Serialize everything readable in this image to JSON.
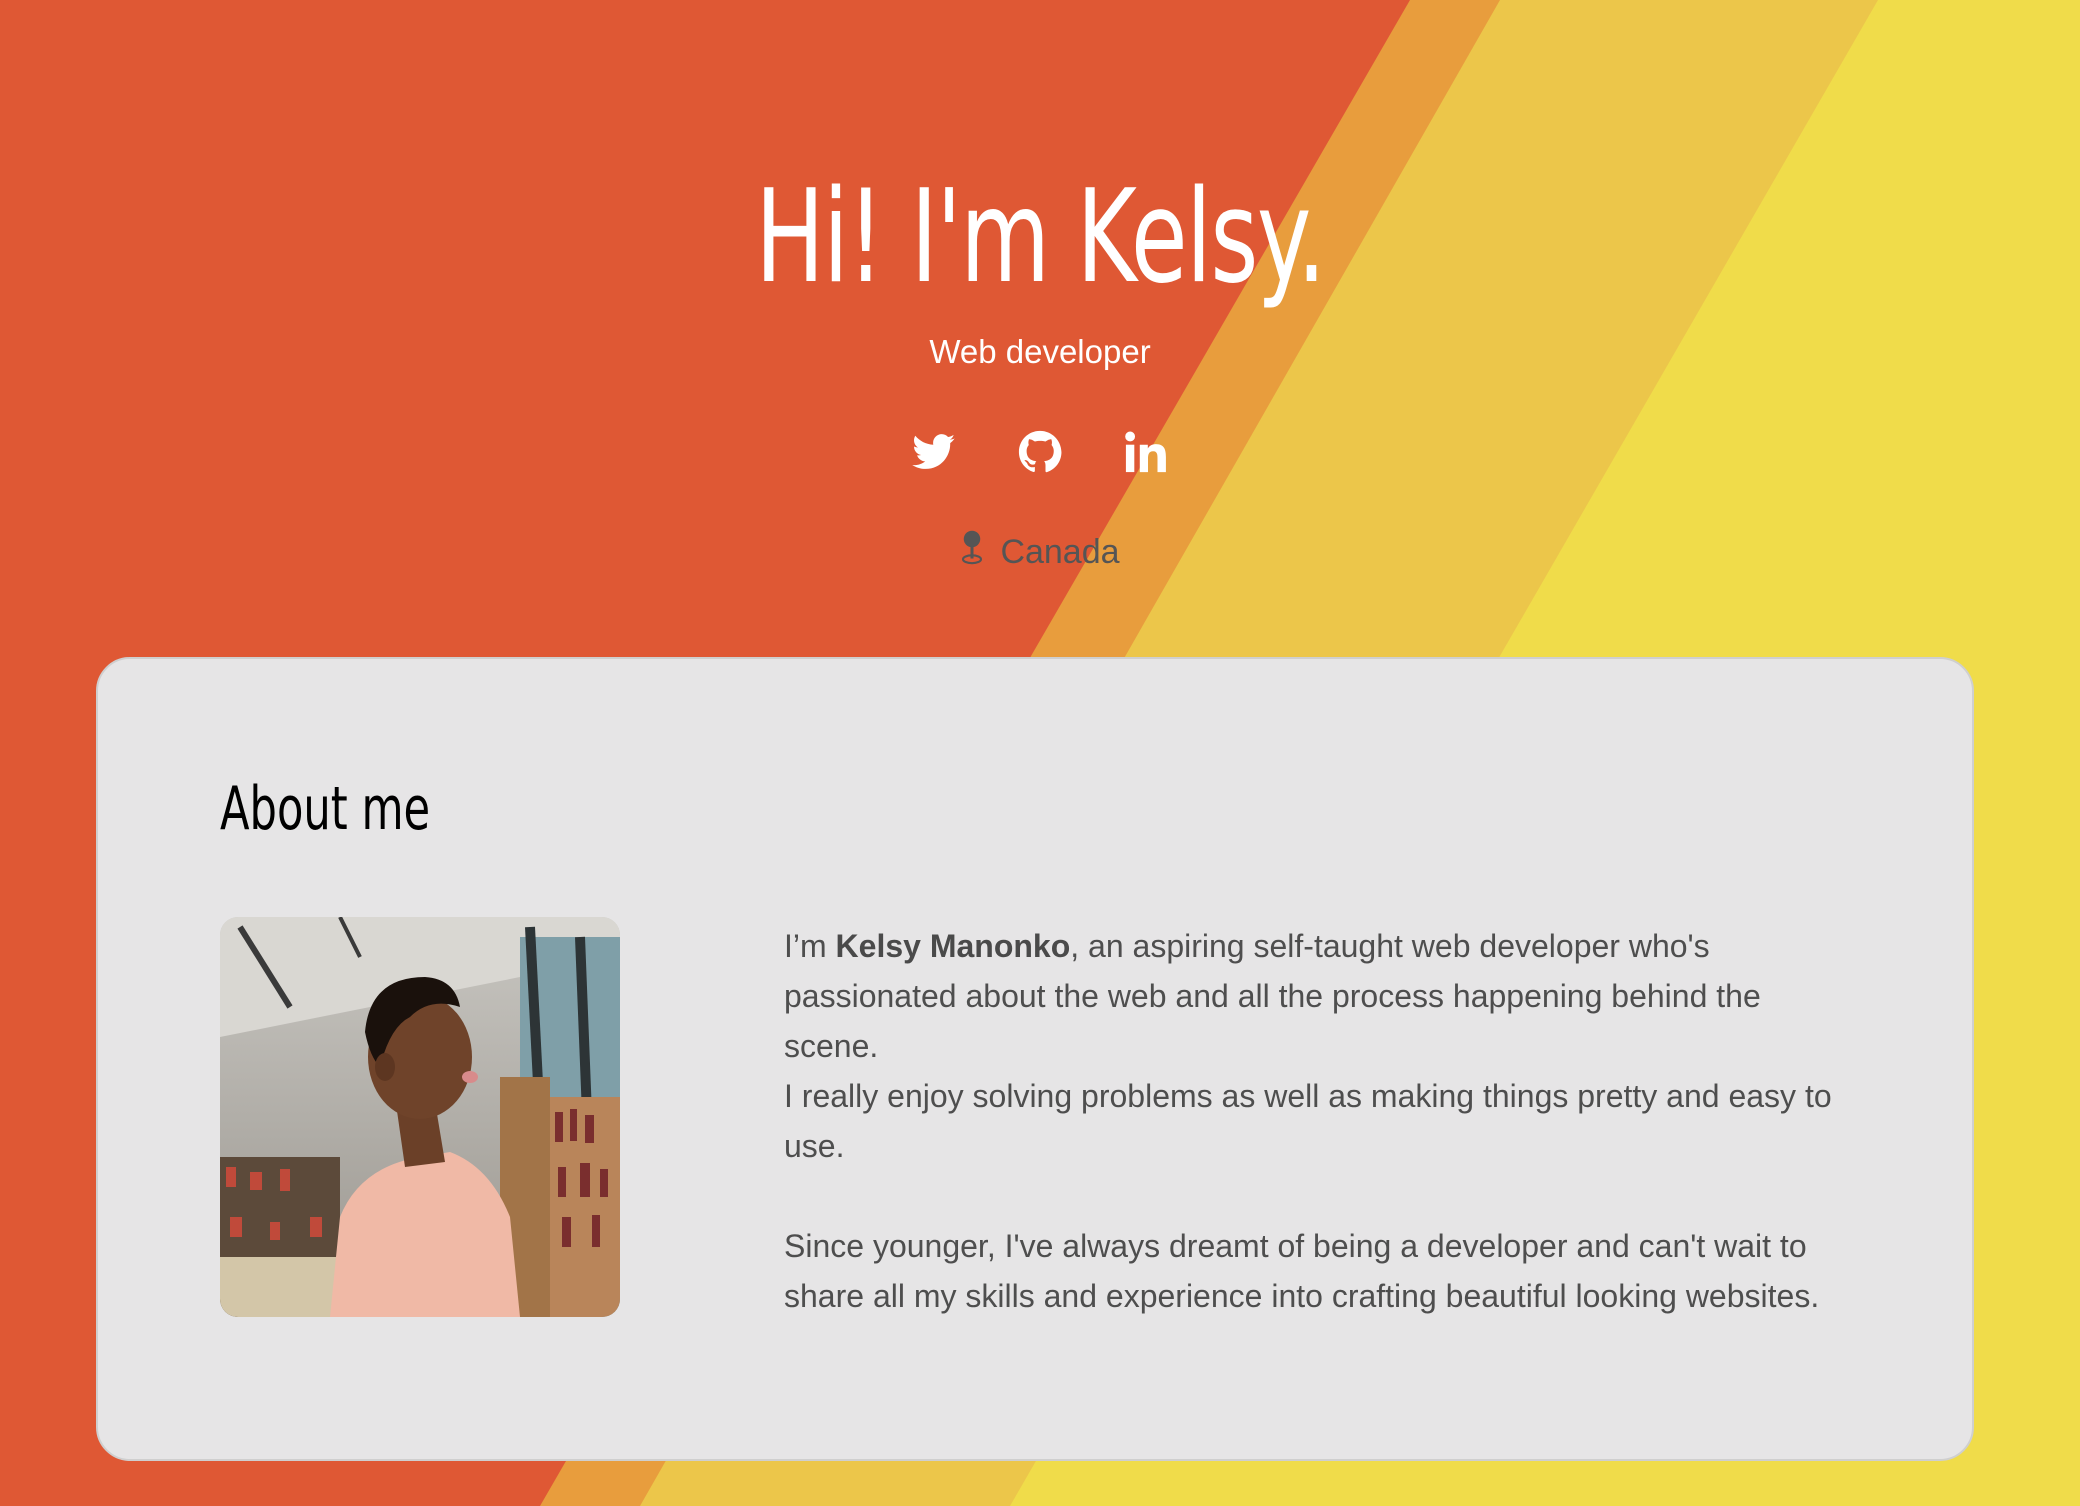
{
  "colors": {
    "orange": "#df5834",
    "stripe_amber": "#e89d3d",
    "stripe_gold": "#ecc64a",
    "yellow": "#f0dc4a",
    "card_bg": "#e6e5e6"
  },
  "hero": {
    "title": "Hi! I'm Kelsy.",
    "subtitle": "Web developer",
    "socials": [
      {
        "name": "twitter",
        "icon": "twitter-icon"
      },
      {
        "name": "github",
        "icon": "github-icon"
      },
      {
        "name": "linkedin",
        "icon": "linkedin-icon"
      }
    ],
    "location": {
      "icon": "map-pin-icon",
      "label": "Canada"
    }
  },
  "about": {
    "title": "About me",
    "photo_icon": "profile-photo",
    "intro_prefix": "I’m ",
    "name": "Kelsy Manonko",
    "intro_rest": ", an aspiring self-taught web developer who's passionated about the web and all the process happening behind the scene.",
    "line2": "I really enjoy solving problems as well as making things pretty and easy to use.",
    "paragraph2": "Since younger, I've always dreamt of being a developer and can't wait to share all my skills and experience into crafting beautiful looking websites."
  }
}
